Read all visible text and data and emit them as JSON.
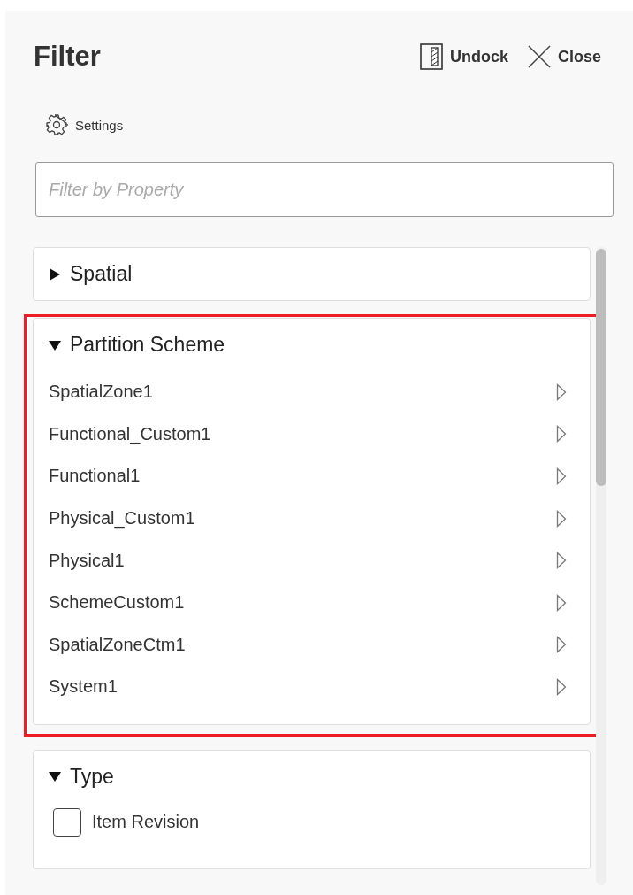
{
  "panel": {
    "title": "Filter",
    "actions": [
      {
        "kind": "undock",
        "label": "Undock"
      },
      {
        "kind": "close",
        "label": "Close"
      }
    ]
  },
  "settings": {
    "label": "Settings"
  },
  "search": {
    "placeholder": "Filter by Property"
  },
  "sections": [
    {
      "title": "Spatial",
      "expanded": false,
      "highlighted": false
    },
    {
      "title": "Partition Scheme",
      "kind": "list",
      "expanded": true,
      "highlighted": true,
      "items": [
        {
          "label": "SpatialZone1"
        },
        {
          "label": "Functional_Custom1"
        },
        {
          "label": "Functional1"
        },
        {
          "label": "Physical_Custom1"
        },
        {
          "label": "Physical1"
        },
        {
          "label": "SchemeCustom1"
        },
        {
          "label": "SpatialZoneCtm1"
        },
        {
          "label": "System1"
        }
      ]
    },
    {
      "title": "Type",
      "kind": "checkboxes",
      "expanded": true,
      "highlighted": false,
      "items": [
        {
          "label": "Item Revision",
          "checked": false
        }
      ]
    }
  ]
}
